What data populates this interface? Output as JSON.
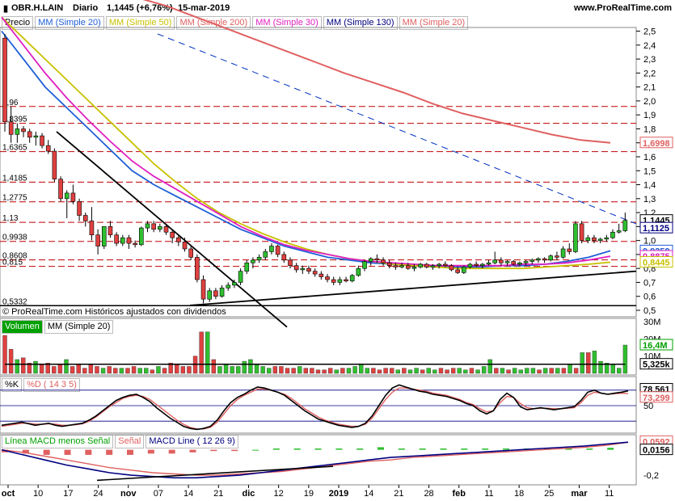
{
  "header": {
    "symbol": "OBR.H.LAIN",
    "period": "Diario",
    "last": "1,1445 (+6,76%)",
    "date": "15-mar-2019",
    "site": "www.ProRealTime.com"
  },
  "price_panel": {
    "legend": [
      {
        "label": "Precio",
        "color": "#000000"
      },
      {
        "label": "MM (Simple 20)",
        "color": "#1f5fd6"
      },
      {
        "label": "MM (Simple 50)",
        "color": "#c8c000"
      },
      {
        "label": "MM (Simple 200)",
        "color": "#e06060"
      },
      {
        "label": "MM (Simple 30)",
        "color": "#e020c0"
      },
      {
        "label": "MM (Simple 130)",
        "color": "#000080"
      },
      {
        "label": "MM (Simple 20)",
        "color": "#e06060"
      }
    ],
    "footer": "© ProRealTime.com  Históricos ajustados con dividendos",
    "level_labels": [
      "1,96",
      "1,8395",
      "1,6365",
      "1,4185",
      "1,2775",
      "1,13",
      "0,9938",
      "0,8608",
      "0,815",
      "0,5332"
    ],
    "right_badges": [
      {
        "text": "1,6998",
        "color": "#e06060"
      },
      {
        "text": "1,1445",
        "color": "#000000"
      },
      {
        "text": "1,1125",
        "color": "#000080"
      },
      {
        "text": "0,9259",
        "color": "#1f5fd6"
      },
      {
        "text": "0,8875",
        "color": "#e020c0"
      },
      {
        "text": "0,8445",
        "color": "#c8c000"
      }
    ]
  },
  "volume_panel": {
    "legend": [
      {
        "label": "Volumen",
        "color": "#00a000"
      },
      {
        "label": "MM (Simple 20)",
        "color": "#000000"
      }
    ],
    "ticks": [
      "30M",
      "20M",
      "10M"
    ],
    "right_badges": [
      {
        "text": "16,4M",
        "color": "#00a000"
      },
      {
        "text": "5,325k",
        "color": "#000000"
      }
    ]
  },
  "stoch_panel": {
    "legend": [
      {
        "label": "%K",
        "color": "#000000"
      },
      {
        "label": "%D ( 14 3 5)",
        "color": "#e06060"
      }
    ],
    "ticks": [
      "50"
    ],
    "right_badges": [
      {
        "text": "78,561",
        "color": "#000000"
      },
      {
        "text": "73,299",
        "color": "#e06060"
      }
    ]
  },
  "macd_panel": {
    "legend": [
      {
        "label": "Línea MACD menos Señal",
        "color": "#00a000"
      },
      {
        "label": "Señal",
        "color": "#e06060"
      },
      {
        "label": "MACD Line ( 12 26 9)",
        "color": "#000080"
      }
    ],
    "ticks": [
      "0,0156",
      "-0,2"
    ],
    "right_badges": [
      {
        "text": "0,0592",
        "color": "#e06060"
      },
      {
        "text": "0,0156",
        "color": "#000000"
      }
    ]
  },
  "chart_data": {
    "type": "line",
    "title": "OBR.H.LAIN Diario",
    "x_labels": [
      "oct",
      "10",
      "17",
      "24",
      "nov",
      "07",
      "14",
      "21",
      "dic",
      "12",
      "19",
      "2019",
      "14",
      "21",
      "28",
      "feb",
      "11",
      "18",
      "25",
      "mar",
      "11"
    ],
    "price_axis": {
      "min": 0.5,
      "max": 2.5,
      "ticks": [
        2.5,
        2.4,
        2.3,
        2.2,
        2.1,
        2.0,
        1.9,
        1.8,
        1.7,
        1.6,
        1.5,
        1.4,
        1.3,
        1.2,
        1.1,
        1.0,
        0.9,
        0.8,
        0.7,
        0.6,
        0.5
      ]
    },
    "candles_ohlc": [
      [
        2.45,
        2.48,
        1.78,
        1.85
      ],
      [
        1.85,
        1.96,
        1.7,
        1.76
      ],
      [
        1.76,
        1.84,
        1.7,
        1.8
      ],
      [
        1.8,
        1.82,
        1.74,
        1.78
      ],
      [
        1.78,
        1.8,
        1.7,
        1.74
      ],
      [
        1.74,
        1.78,
        1.68,
        1.75
      ],
      [
        1.75,
        1.77,
        1.66,
        1.68
      ],
      [
        1.68,
        1.72,
        1.62,
        1.64
      ],
      [
        1.64,
        1.66,
        1.42,
        1.44
      ],
      [
        1.44,
        1.46,
        1.28,
        1.3
      ],
      [
        1.3,
        1.36,
        1.16,
        1.34
      ],
      [
        1.34,
        1.4,
        1.26,
        1.28
      ],
      [
        1.28,
        1.3,
        1.14,
        1.18
      ],
      [
        1.18,
        1.2,
        1.1,
        1.14
      ],
      [
        1.14,
        1.24,
        1.0,
        1.04
      ],
      [
        1.04,
        1.08,
        0.9,
        0.96
      ],
      [
        0.96,
        1.1,
        0.94,
        1.1
      ],
      [
        1.1,
        1.14,
        1.02,
        1.04
      ],
      [
        1.04,
        1.06,
        0.96,
        0.98
      ],
      [
        0.98,
        1.04,
        0.96,
        1.02
      ],
      [
        1.02,
        1.04,
        0.94,
        0.98
      ],
      [
        0.98,
        1.0,
        0.95,
        0.97
      ],
      [
        0.97,
        1.1,
        0.96,
        1.09
      ],
      [
        1.09,
        1.14,
        1.06,
        1.12
      ],
      [
        1.12,
        1.14,
        1.06,
        1.08
      ],
      [
        1.08,
        1.12,
        1.06,
        1.1
      ],
      [
        1.1,
        1.12,
        1.04,
        1.06
      ],
      [
        1.06,
        1.08,
        0.98,
        1.02
      ],
      [
        1.02,
        1.04,
        0.96,
        0.99
      ],
      [
        0.99,
        1.02,
        0.92,
        0.94
      ],
      [
        0.94,
        0.96,
        0.86,
        0.88
      ],
      [
        0.88,
        0.9,
        0.7,
        0.72
      ],
      [
        0.72,
        0.75,
        0.55,
        0.58
      ],
      [
        0.58,
        0.66,
        0.56,
        0.64
      ],
      [
        0.64,
        0.66,
        0.58,
        0.6
      ],
      [
        0.6,
        0.68,
        0.59,
        0.66
      ],
      [
        0.66,
        0.7,
        0.64,
        0.68
      ],
      [
        0.68,
        0.72,
        0.66,
        0.7
      ],
      [
        0.7,
        0.8,
        0.68,
        0.78
      ],
      [
        0.78,
        0.86,
        0.76,
        0.84
      ],
      [
        0.84,
        0.88,
        0.8,
        0.86
      ],
      [
        0.86,
        0.9,
        0.84,
        0.88
      ],
      [
        0.88,
        0.94,
        0.86,
        0.92
      ],
      [
        0.92,
        0.98,
        0.9,
        0.96
      ],
      [
        0.96,
        0.97,
        0.88,
        0.9
      ],
      [
        0.9,
        0.92,
        0.84,
        0.86
      ],
      [
        0.86,
        0.88,
        0.8,
        0.82
      ],
      [
        0.82,
        0.84,
        0.77,
        0.79
      ],
      [
        0.79,
        0.82,
        0.76,
        0.8
      ],
      [
        0.8,
        0.82,
        0.76,
        0.78
      ],
      [
        0.78,
        0.8,
        0.74,
        0.76
      ],
      [
        0.76,
        0.78,
        0.72,
        0.74
      ],
      [
        0.74,
        0.76,
        0.7,
        0.72
      ],
      [
        0.72,
        0.74,
        0.68,
        0.7
      ],
      [
        0.7,
        0.74,
        0.68,
        0.72
      ],
      [
        0.72,
        0.74,
        0.7,
        0.71
      ],
      [
        0.71,
        0.76,
        0.7,
        0.75
      ],
      [
        0.75,
        0.82,
        0.74,
        0.8
      ],
      [
        0.8,
        0.86,
        0.78,
        0.85
      ],
      [
        0.85,
        0.88,
        0.82,
        0.87
      ],
      [
        0.87,
        0.9,
        0.84,
        0.86
      ],
      [
        0.86,
        0.88,
        0.82,
        0.84
      ],
      [
        0.84,
        0.86,
        0.8,
        0.82
      ],
      [
        0.82,
        0.84,
        0.79,
        0.81
      ],
      [
        0.81,
        0.84,
        0.8,
        0.82
      ],
      [
        0.82,
        0.84,
        0.79,
        0.8
      ],
      [
        0.8,
        0.83,
        0.78,
        0.81
      ],
      [
        0.81,
        0.84,
        0.8,
        0.83
      ],
      [
        0.83,
        0.84,
        0.8,
        0.81
      ],
      [
        0.81,
        0.83,
        0.79,
        0.82
      ],
      [
        0.82,
        0.84,
        0.8,
        0.83
      ],
      [
        0.83,
        0.85,
        0.81,
        0.82
      ],
      [
        0.82,
        0.83,
        0.78,
        0.79
      ],
      [
        0.79,
        0.81,
        0.76,
        0.77
      ],
      [
        0.77,
        0.82,
        0.76,
        0.81
      ],
      [
        0.81,
        0.84,
        0.8,
        0.83
      ],
      [
        0.83,
        0.85,
        0.81,
        0.82
      ],
      [
        0.82,
        0.84,
        0.8,
        0.83
      ],
      [
        0.83,
        0.86,
        0.82,
        0.84
      ],
      [
        0.84,
        0.92,
        0.83,
        0.86
      ],
      [
        0.86,
        0.88,
        0.82,
        0.84
      ],
      [
        0.84,
        0.86,
        0.82,
        0.85
      ],
      [
        0.85,
        0.86,
        0.82,
        0.83
      ],
      [
        0.83,
        0.85,
        0.82,
        0.84
      ],
      [
        0.84,
        0.86,
        0.82,
        0.85
      ],
      [
        0.85,
        0.87,
        0.83,
        0.86
      ],
      [
        0.86,
        0.88,
        0.84,
        0.87
      ],
      [
        0.87,
        0.88,
        0.84,
        0.86
      ],
      [
        0.86,
        0.9,
        0.85,
        0.89
      ],
      [
        0.89,
        0.92,
        0.86,
        0.88
      ],
      [
        0.88,
        0.96,
        0.87,
        0.94
      ],
      [
        0.94,
        0.98,
        0.9,
        0.92
      ],
      [
        0.92,
        1.14,
        0.91,
        1.12
      ],
      [
        1.12,
        1.14,
        0.98,
        1.0
      ],
      [
        1.0,
        1.04,
        0.98,
        1.02
      ],
      [
        1.02,
        1.04,
        0.98,
        1.0
      ],
      [
        1.0,
        1.02,
        0.98,
        1.01
      ],
      [
        1.01,
        1.04,
        0.99,
        1.02
      ],
      [
        1.02,
        1.08,
        1.01,
        1.06
      ],
      [
        1.06,
        1.12,
        1.05,
        1.07
      ],
      [
        1.07,
        1.2,
        1.06,
        1.1445
      ]
    ],
    "series": [
      {
        "name": "MM (Simple 20)",
        "color": "#1f5fd6",
        "values": [
          2.5,
          2.3,
          2.1,
          1.95,
          1.8,
          1.65,
          1.5,
          1.4,
          1.32,
          1.24,
          1.16,
          1.08,
          1.02,
          0.96,
          0.92,
          0.88,
          0.86,
          0.84,
          0.83,
          0.82,
          0.81,
          0.81,
          0.81,
          0.82,
          0.82,
          0.83,
          0.85,
          0.88,
          0.9259
        ]
      },
      {
        "name": "MM (Simple 50)",
        "color": "#c8c000",
        "values": [
          2.6,
          2.45,
          2.3,
          2.15,
          2.0,
          1.85,
          1.7,
          1.55,
          1.42,
          1.3,
          1.2,
          1.12,
          1.05,
          0.99,
          0.94,
          0.9,
          0.87,
          0.85,
          0.83,
          0.82,
          0.81,
          0.8,
          0.8,
          0.8,
          0.8,
          0.81,
          0.82,
          0.83,
          0.8445
        ]
      },
      {
        "name": "MM (Simple 30)",
        "color": "#e020c0",
        "values": [
          2.6,
          2.4,
          2.2,
          2.02,
          1.86,
          1.71,
          1.57,
          1.46,
          1.37,
          1.28,
          1.19,
          1.1,
          1.03,
          0.97,
          0.93,
          0.9,
          0.87,
          0.85,
          0.84,
          0.83,
          0.82,
          0.82,
          0.82,
          0.82,
          0.83,
          0.83,
          0.84,
          0.86,
          0.8875
        ]
      },
      {
        "name": "MM (Simple 200)",
        "color": "#e06060",
        "values": [
          2.9,
          2.85,
          2.8,
          2.74,
          2.68,
          2.6,
          2.52,
          2.44,
          2.36,
          2.28,
          2.2,
          2.13,
          2.06,
          1.98,
          1.91,
          1.86,
          1.81,
          1.76,
          1.72,
          1.6998
        ]
      }
    ],
    "volume": [
      22,
      14,
      8,
      9,
      6,
      7,
      5,
      6,
      4,
      5,
      8,
      4,
      5,
      3,
      5,
      4,
      3,
      4,
      3,
      3,
      3,
      4,
      3,
      3,
      2,
      4,
      3,
      6,
      5,
      4,
      4,
      10,
      24,
      24,
      8,
      4,
      5,
      4,
      4,
      7,
      8,
      5,
      4,
      3,
      4,
      4,
      3,
      3,
      4,
      3,
      3,
      2,
      2,
      3,
      2,
      3,
      3,
      4,
      5,
      3,
      3,
      2,
      3,
      3,
      2,
      3,
      2,
      3,
      2,
      3,
      2,
      3,
      2,
      3,
      3,
      2,
      3,
      2,
      4,
      8,
      3,
      3,
      2,
      3,
      2,
      3,
      3,
      2,
      3,
      3,
      3,
      3,
      5,
      3,
      12,
      12,
      13,
      7,
      6,
      5,
      3,
      16.4
    ],
    "stoch_k": [
      12,
      14,
      16,
      18,
      15,
      12,
      14,
      16,
      12,
      10,
      12,
      14,
      16,
      22,
      30,
      40,
      50,
      60,
      66,
      70,
      72,
      66,
      58,
      46,
      36,
      26,
      18,
      10,
      6,
      4,
      6,
      10,
      22,
      40,
      56,
      66,
      72,
      80,
      86,
      84,
      80,
      76,
      70,
      60,
      50,
      40,
      32,
      24,
      20,
      16,
      12,
      10,
      8,
      10,
      16,
      30,
      50,
      70,
      84,
      90,
      86,
      82,
      78,
      76,
      72,
      70,
      68,
      64,
      60,
      54,
      50,
      40,
      34,
      40,
      62,
      74,
      66,
      48,
      42,
      44,
      46,
      44,
      42,
      44,
      46,
      48,
      60,
      76,
      80,
      74,
      72,
      74,
      76,
      78.561
    ],
    "stoch_d": [
      10,
      12,
      14,
      16,
      16,
      14,
      14,
      15,
      14,
      12,
      12,
      13,
      15,
      20,
      28,
      38,
      48,
      56,
      64,
      68,
      70,
      68,
      62,
      52,
      42,
      32,
      22,
      14,
      8,
      5,
      5,
      8,
      18,
      34,
      50,
      62,
      70,
      76,
      82,
      82,
      80,
      76,
      72,
      64,
      54,
      44,
      36,
      28,
      22,
      18,
      14,
      12,
      10,
      10,
      14,
      26,
      44,
      62,
      76,
      84,
      84,
      82,
      80,
      78,
      74,
      72,
      70,
      66,
      62,
      56,
      52,
      44,
      38,
      40,
      56,
      68,
      66,
      54,
      46,
      44,
      45,
      45,
      44,
      44,
      45,
      46,
      56,
      70,
      76,
      74,
      72,
      73,
      74,
      73.299
    ],
    "macd_line": [
      0,
      -0.04,
      -0.08,
      -0.12,
      -0.15,
      -0.18,
      -0.2,
      -0.21,
      -0.22,
      -0.22,
      -0.21,
      -0.2,
      -0.18,
      -0.16,
      -0.14,
      -0.12,
      -0.1,
      -0.08,
      -0.06,
      -0.05,
      -0.04,
      -0.03,
      -0.02,
      -0.01,
      0,
      0.01,
      0.02,
      0.03,
      0.045,
      0.06
    ],
    "macd_signal": [
      0,
      -0.02,
      -0.05,
      -0.08,
      -0.11,
      -0.14,
      -0.16,
      -0.18,
      -0.19,
      -0.2,
      -0.2,
      -0.19,
      -0.18,
      -0.17,
      -0.15,
      -0.13,
      -0.11,
      -0.09,
      -0.08,
      -0.06,
      -0.05,
      -0.04,
      -0.03,
      -0.02,
      -0.01,
      0,
      0.01,
      0.02,
      0.035,
      0.0592
    ],
    "macd_hist": [
      -0.02,
      -0.03,
      -0.04,
      -0.04,
      -0.04,
      -0.04,
      -0.04,
      -0.03,
      -0.03,
      -0.02,
      -0.01,
      -0.01,
      0,
      0.01,
      0.01,
      0.01,
      0.01,
      0.01,
      0.02,
      0.01,
      0.01,
      0.01,
      0.01,
      0.01,
      0.01,
      0.01,
      0.01,
      0.01,
      0.01,
      0.0156
    ],
    "ylim_volume": [
      0,
      30
    ],
    "ylim_stoch": [
      0,
      100
    ],
    "ylim_macd": [
      -0.25,
      0.08
    ]
  }
}
